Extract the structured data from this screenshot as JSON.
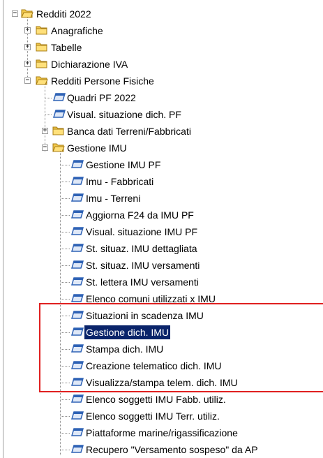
{
  "tree": {
    "root": {
      "label": "Redditi 2022",
      "expanded": true,
      "icon": "folder-open-icon"
    },
    "children": [
      {
        "label": "Anagrafiche",
        "icon": "folder-icon",
        "expander": "+"
      },
      {
        "label": "Tabelle",
        "icon": "folder-icon",
        "expander": "+"
      },
      {
        "label": "Dichiarazione IVA",
        "icon": "folder-icon",
        "expander": "+"
      },
      {
        "label": "Redditi Persone Fisiche",
        "icon": "folder-open-icon",
        "expander": "-"
      }
    ],
    "persone_fisiche": [
      {
        "label": "Quadri PF 2022",
        "icon": "program-icon"
      },
      {
        "label": "Visual. situazione dich. PF",
        "icon": "program-icon"
      },
      {
        "label": "Banca dati Terreni/Fabbricati",
        "icon": "folder-icon",
        "expander": "+"
      },
      {
        "label": "Gestione IMU",
        "icon": "folder-open-icon",
        "expander": "-"
      }
    ],
    "gestione_imu": [
      {
        "label": "Gestione IMU PF"
      },
      {
        "label": "Imu - Fabbricati"
      },
      {
        "label": "Imu - Terreni"
      },
      {
        "label": "Aggiorna F24 da IMU PF"
      },
      {
        "label": "Visual. situazione IMU PF"
      },
      {
        "label": "St. situaz. IMU dettagliata"
      },
      {
        "label": "St. situaz. IMU versamenti"
      },
      {
        "label": "St. lettera IMU versamenti"
      },
      {
        "label": "Elenco comuni utilizzati x IMU"
      },
      {
        "label": "Situazioni in scadenza IMU"
      },
      {
        "label": "Gestione dich. IMU",
        "selected": true
      },
      {
        "label": "Stampa   dich. IMU"
      },
      {
        "label": "Creazione telematico dich. IMU"
      },
      {
        "label": "Visualizza/stampa telem. dich. IMU"
      },
      {
        "label": "Elenco soggetti IMU  Fabb. utiliz."
      },
      {
        "label": "Elenco soggetti IMU  Terr. utiliz."
      },
      {
        "label": "Piattaforme marine/rigassificazione"
      },
      {
        "label": "Recupero \"Versamento sospeso\" da AP"
      }
    ]
  },
  "colors": {
    "selection": "#0a246a",
    "highlight_box": "#e02020",
    "folder": "#f2c94c",
    "program_icon": "#2e62b5"
  }
}
